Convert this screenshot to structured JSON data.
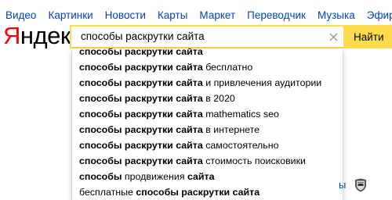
{
  "nav": {
    "items": [
      "Видео",
      "Картинки",
      "Новости",
      "Карты",
      "Маркет",
      "Переводчик",
      "Музыка",
      "Эфир"
    ]
  },
  "logo": {
    "first_letter": "Я",
    "rest": "ндекс"
  },
  "search": {
    "query": "способы раскрутки сайта",
    "clear_icon": "close-icon",
    "button_label": "Найти",
    "accent_color": "#ffdb4d"
  },
  "suggestions": [
    {
      "bold": "способы раскрутки сайта",
      "rest": ""
    },
    {
      "bold": "способы раскрутки сайта",
      "rest": " бесплатно"
    },
    {
      "bold": "способы раскрутки сайта",
      "rest": " и привлечения аудитории"
    },
    {
      "bold": "способы раскрутки сайта",
      "rest": " в 2020"
    },
    {
      "bold": "способы раскрутки сайта",
      "rest": " mathematics seo"
    },
    {
      "bold": "способы раскрутки сайта",
      "rest": " в интернете"
    },
    {
      "bold": "способы раскрутки сайта",
      "rest": " самостоятельно"
    },
    {
      "bold": "способы раскрутки сайта",
      "rest": " стоимость поисковики"
    },
    {
      "pre": "",
      "bold": "способы",
      "mid": " продвижения ",
      "bold2": "сайта"
    },
    {
      "pre": "бесплатные ",
      "bold": "способы раскрутки сайта",
      "rest": ""
    }
  ],
  "side": {
    "link_fragment": "ы",
    "icon": "nhl-icon"
  },
  "colors": {
    "link": "#0044bb",
    "logo_red": "#ff0000"
  }
}
